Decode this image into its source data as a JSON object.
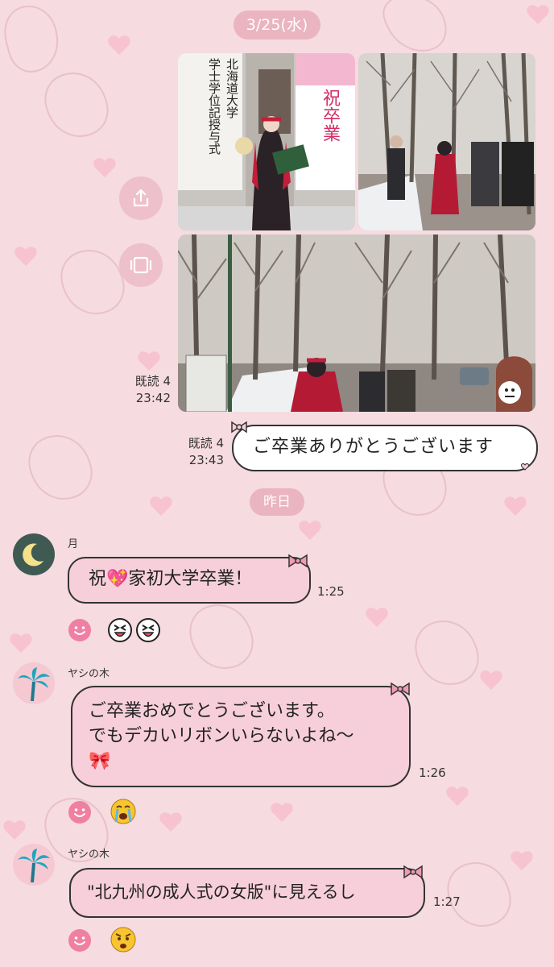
{
  "date_pill": "3/25(水)",
  "yesterday_pill": "昨日",
  "sent": {
    "read_1": "既読 4",
    "time_1": "23:42",
    "read_2": "既読 4",
    "time_2": "23:43",
    "message": "ご卒業ありがとうございます"
  },
  "photos": {
    "signboard_lines": [
      "北海道大学",
      "学士学位記授与式"
    ],
    "banner_text": "祝卒業"
  },
  "messages": [
    {
      "sender": "月",
      "text": "祝💖家初大学卒業！",
      "time": "1:25"
    },
    {
      "sender": "ヤシの木",
      "text_line1": "ご卒業おめでとうございます。",
      "text_line2": "でもデカいリボンいらないよね～",
      "text_line3": "🎀",
      "time": "1:26"
    },
    {
      "sender": "ヤシの木",
      "text": "\"北九州の成人式の女版\"に見えるし",
      "time": "1:27"
    }
  ],
  "colors": {
    "background": "#f6dbe1",
    "pill": "#eab4c1",
    "accent_pink": "#ef7fa3",
    "bubble_pink": "#f7cfdb"
  },
  "icons": [
    "share-icon",
    "screen-icon",
    "moon-icon",
    "palm-tree-icon",
    "smile-icon",
    "reaction-emoji"
  ]
}
